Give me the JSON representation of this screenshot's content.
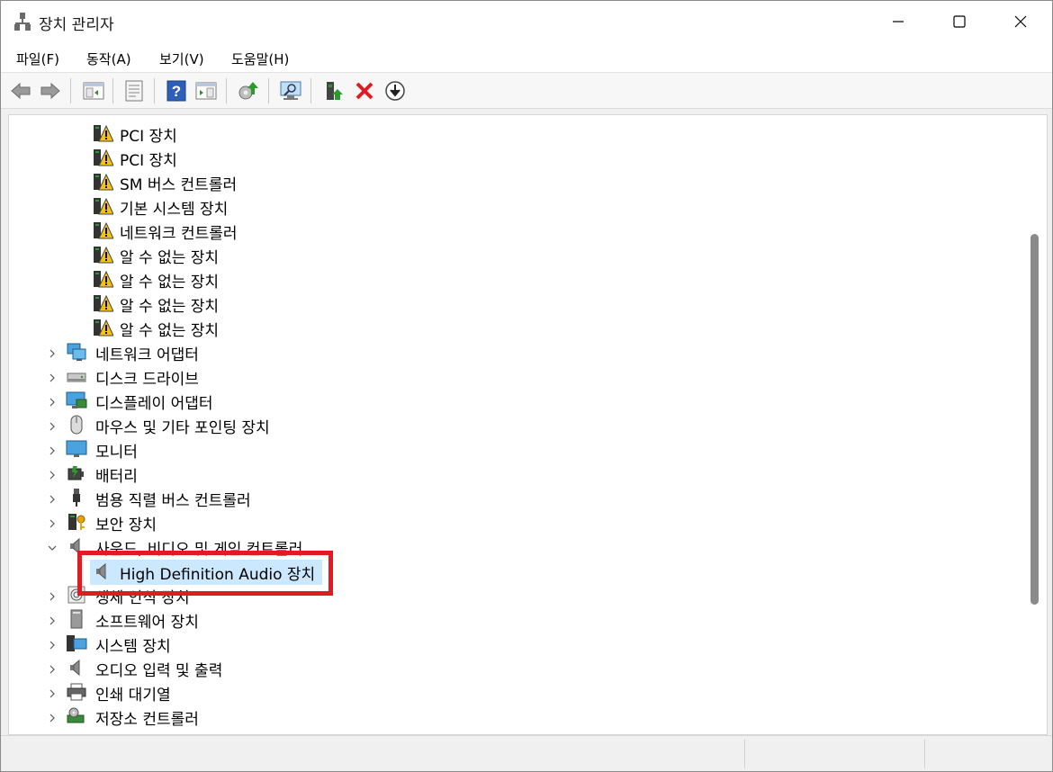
{
  "window": {
    "title": "장치 관리자"
  },
  "menu": {
    "items": [
      "파일(F)",
      "동작(A)",
      "보기(V)",
      "도움말(H)"
    ]
  },
  "toolbar": {
    "buttons": [
      "back-icon",
      "forward-icon",
      "show-hide-console-tree-icon",
      "properties-icon",
      "help-icon",
      "run-action-icon",
      "update-driver-icon",
      "scan-hardware-icon",
      "enable-device-icon",
      "uninstall-device-icon",
      "download-icon"
    ]
  },
  "tree": {
    "child_items": [
      "PCI 장치",
      "PCI 장치",
      "SM 버스 컨트롤러",
      "기본 시스템 장치",
      "네트워크 컨트롤러",
      "알 수 없는 장치",
      "알 수 없는 장치",
      "알 수 없는 장치",
      "알 수 없는 장치"
    ],
    "categories": {
      "network": "네트워크 어댑터",
      "disk": "디스크 드라이브",
      "display": "디스플레이 어댑터",
      "mouse": "마우스 및 기타 포인팅 장치",
      "monitor": "모니터",
      "battery": "배터리",
      "usb": "범용 직렬 버스 컨트롤러",
      "security": "보안 장치",
      "sound": "사운드, 비디오 및 게임 컨트롤러",
      "sound_child": "High Definition Audio 장치",
      "biometric": "생체 인식 장치",
      "software": "소프트웨어 장치",
      "system": "시스템 장치",
      "audio_io": "오디오 입력 및 출력",
      "print_queue": "인쇄 대기열",
      "storage": "저장소 컨트롤러"
    }
  },
  "colors": {
    "highlight_border": "#e01b24",
    "selection": "#cce8ff",
    "warning": "#f5c211"
  }
}
